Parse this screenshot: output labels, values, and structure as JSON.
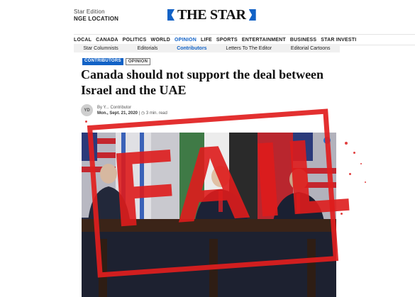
{
  "edition": {
    "line1": "Star Edition",
    "line2": "NGE LOCATION"
  },
  "logo": {
    "text": "THE STAR"
  },
  "nav": [
    "LOCAL",
    "CANADA",
    "POLITICS",
    "WORLD",
    "OPINION",
    "LIFE",
    "SPORTS",
    "ENTERTAINMENT",
    "BUSINESS",
    "STAR INVESTI"
  ],
  "nav_active": "OPINION",
  "subnav": [
    "Star Columnists",
    "Editorials",
    "Contributors",
    "Letters To The Editor",
    "Editorial Cartoons"
  ],
  "subnav_active": "Contributors",
  "tags": {
    "primary": "CONTRIBUTORS",
    "secondary": "OPINION"
  },
  "article": {
    "headline": "Canada should not support the deal between Israel and the UAE",
    "avatar_initials": "YD",
    "byline": "By Y... Contributor",
    "date": "Mon., Sept. 21, 2020",
    "read_time": "3 min. read"
  },
  "stamp": {
    "text": "FAIL"
  },
  "colors": {
    "brand_blue": "#1262c6",
    "stamp_red": "#de1c1c"
  }
}
